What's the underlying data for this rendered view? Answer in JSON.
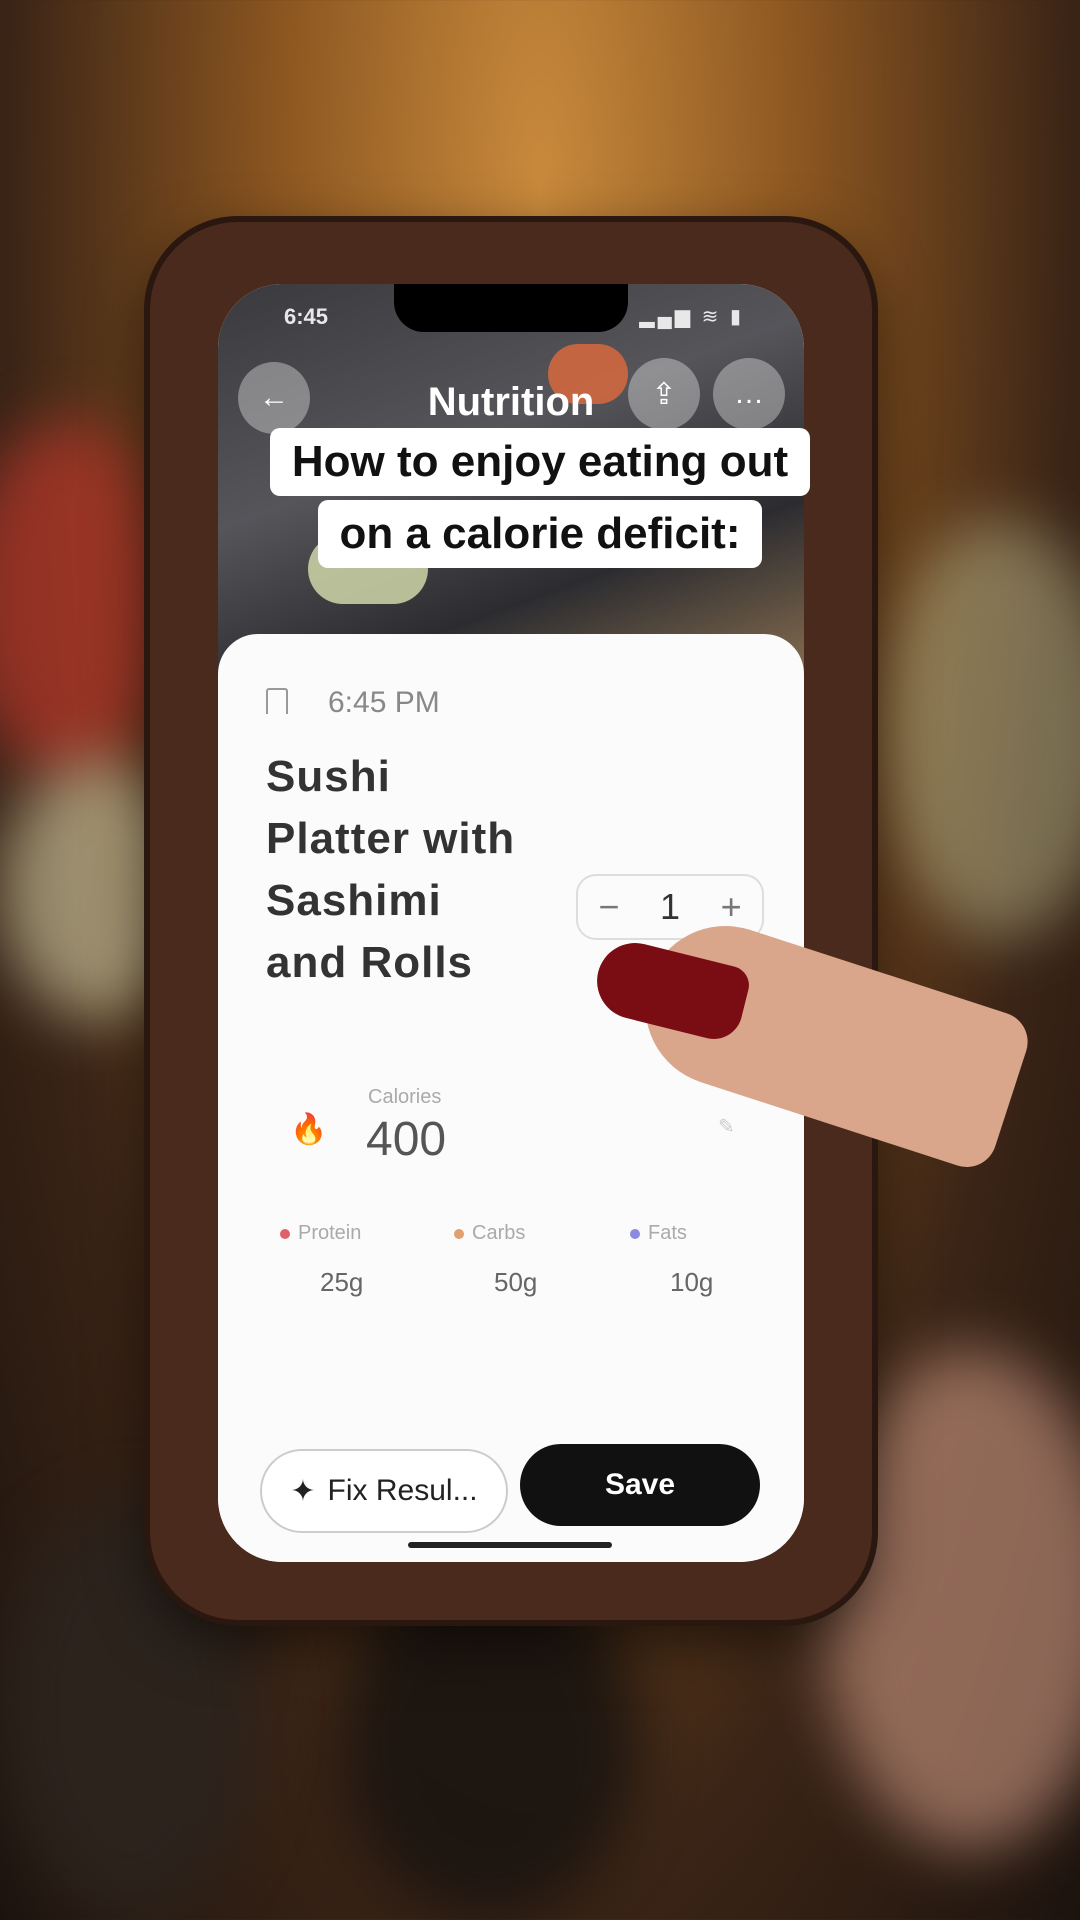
{
  "status_bar": {
    "time": "6:45",
    "icons": "▂▄▆ ≋ ▮"
  },
  "nav": {
    "title": "Nutrition",
    "back_icon": "←",
    "share_icon": "⇪",
    "more_icon": "…"
  },
  "caption": {
    "line1": "How to enjoy eating out",
    "line2": "on a calorie deficit:"
  },
  "meal": {
    "time": "6:45 PM",
    "title": "Sushi Platter with Sashimi and Rolls",
    "quantity": "1",
    "minus": "−",
    "plus": "+"
  },
  "calories": {
    "label": "Calories",
    "value": "400",
    "icon": "🔥"
  },
  "macros": [
    {
      "label": "Protein",
      "value": "25g",
      "color": "#e0606a"
    },
    {
      "label": "Carbs",
      "value": "50g",
      "color": "#e0a070"
    },
    {
      "label": "Fats",
      "value": "10g",
      "color": "#8a8ae0"
    }
  ],
  "actions": {
    "fix": "Fix Resul...",
    "fix_icon": "✦",
    "save": "Save"
  }
}
